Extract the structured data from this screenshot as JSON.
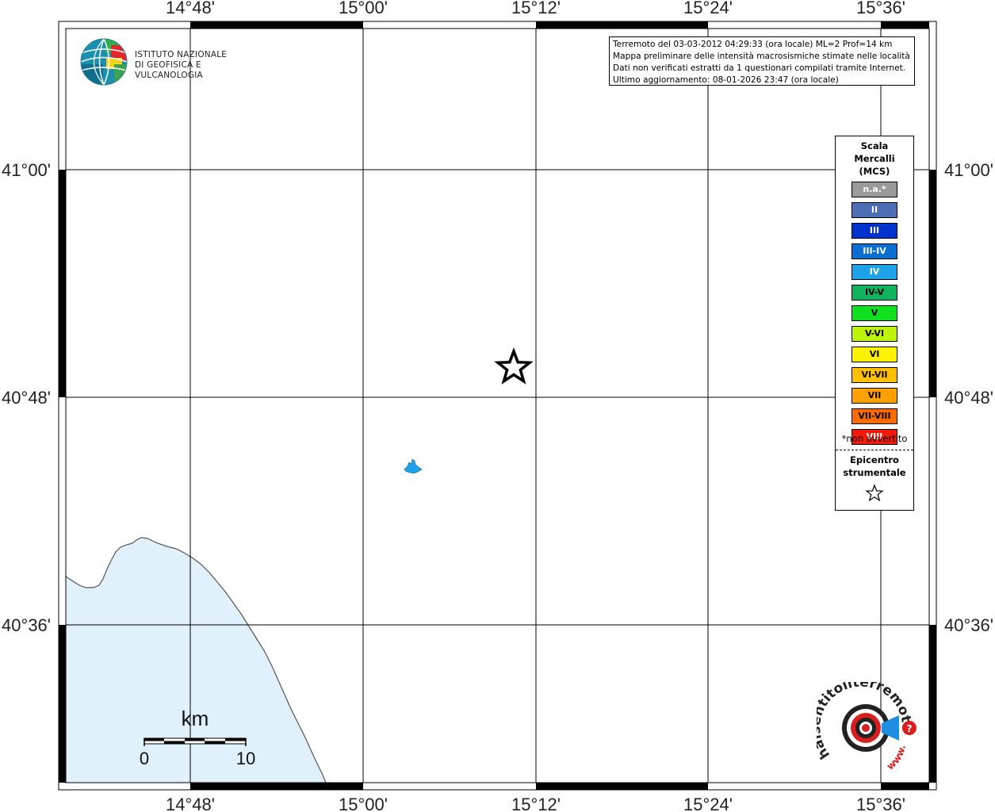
{
  "info": {
    "line1": "Terremoto del 03-03-2012 04:29:33 (ora locale) ML=2 Prof=14 km",
    "line2": "Mappa preliminare delle intensità macrosismiche stimate nelle località",
    "line3": "Dati non verificati estratti da 1 questionari compilati tramite Internet.",
    "line4": "Ultimo aggiornamento: 08-01-2026 23:47 (ora locale)"
  },
  "logo": {
    "line1": "ISTITUTO NAZIONALE",
    "line2": "DI GEOFISICA E VULCANOLOGIA"
  },
  "axes": {
    "lon_labels": [
      "14°48'",
      "15°00'",
      "15°12'",
      "15°24'",
      "15°36'"
    ],
    "lat_labels": [
      "41°00'",
      "40°48'",
      "40°36'"
    ]
  },
  "scale_bar": {
    "unit": "km",
    "start": "0",
    "end": "10"
  },
  "legend": {
    "title": [
      "Scala",
      "Mercalli",
      "(MCS)"
    ],
    "items": [
      {
        "label": "n.a.*",
        "color": "#9a9a9a",
        "text_color": "#ffffff"
      },
      {
        "label": "II",
        "color": "#4d6db4",
        "text_color": "#ffffff"
      },
      {
        "label": "III",
        "color": "#0033cc",
        "text_color": "#ffffff"
      },
      {
        "label": "III-IV",
        "color": "#0a6fd0",
        "text_color": "#ffffff"
      },
      {
        "label": "IV",
        "color": "#1ea3e8",
        "text_color": "#ffffff"
      },
      {
        "label": "IV-V",
        "color": "#12b35f",
        "text_color": "#000000"
      },
      {
        "label": "V",
        "color": "#10e020",
        "text_color": "#000000"
      },
      {
        "label": "V-VI",
        "color": "#bdf20a",
        "text_color": "#000000"
      },
      {
        "label": "VI",
        "color": "#fdf200",
        "text_color": "#000000"
      },
      {
        "label": "VI-VII",
        "color": "#fdbf00",
        "text_color": "#000000"
      },
      {
        "label": "VII",
        "color": "#fda000",
        "text_color": "#000000"
      },
      {
        "label": "VII-VIII",
        "color": "#fd6a00",
        "text_color": "#000000"
      },
      {
        "label": "VIII",
        "color": "#f41a0a",
        "text_color": "#ffffff"
      }
    ],
    "note": "*non avvertito",
    "epicenter_label": [
      "Epicentro",
      "strumentale"
    ]
  },
  "colors": {
    "sea": "#e1f1fb",
    "coast": "#555555",
    "grid": "#000000",
    "locality": "#1ea3e8"
  },
  "watermark": {
    "text": "www.haisentitoilterremoto.it",
    "accent": "#d81e1e"
  }
}
